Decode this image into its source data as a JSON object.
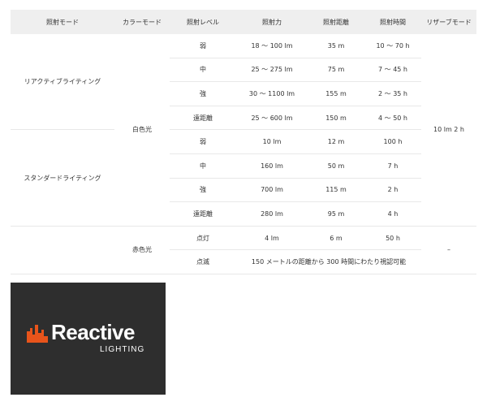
{
  "headers": [
    "照射モード",
    "カラーモード",
    "照射レベル",
    "照射力",
    "照射距離",
    "照射時間",
    "リザーブモード"
  ],
  "modes": {
    "reactive": "リアクティブライティング",
    "standard": "スタンダードライティング"
  },
  "colors": {
    "white": "白色光",
    "red": "赤色光"
  },
  "reserve": {
    "white": "10 lm 2 h",
    "red": "–"
  },
  "reactive_rows": [
    {
      "level": "弱",
      "power": "18 〜 100 lm",
      "distance": "35 m",
      "time": "10 〜 70 h"
    },
    {
      "level": "中",
      "power": "25 〜 275 lm",
      "distance": "75 m",
      "time": "7 〜 45 h"
    },
    {
      "level": "強",
      "power": "30 〜 1100 lm",
      "distance": "155 m",
      "time": "2 〜 35 h"
    },
    {
      "level": "遠距離",
      "power": "25 〜 600 lm",
      "distance": "150 m",
      "time": "4 〜 50 h"
    }
  ],
  "standard_rows": [
    {
      "level": "弱",
      "power": "10 lm",
      "distance": "12 m",
      "time": "100 h"
    },
    {
      "level": "中",
      "power": "160 lm",
      "distance": "50 m",
      "time": "7 h"
    },
    {
      "level": "強",
      "power": "700 lm",
      "distance": "115 m",
      "time": "2 h"
    },
    {
      "level": "遠距離",
      "power": "280 lm",
      "distance": "95 m",
      "time": "4 h"
    }
  ],
  "red_rows": {
    "steady": {
      "level": "点灯",
      "power": "4 lm",
      "distance": "6 m",
      "time": "50 h"
    },
    "blink": {
      "level": "点滅",
      "note": "150 メートルの距離から 300 時間にわたり視認可能"
    }
  },
  "logo": {
    "word": "Reactive",
    "sub": "LIGHTING",
    "colors": {
      "background": "#2e2e2e",
      "icon": "#e8541b",
      "text": "#ffffff"
    }
  }
}
